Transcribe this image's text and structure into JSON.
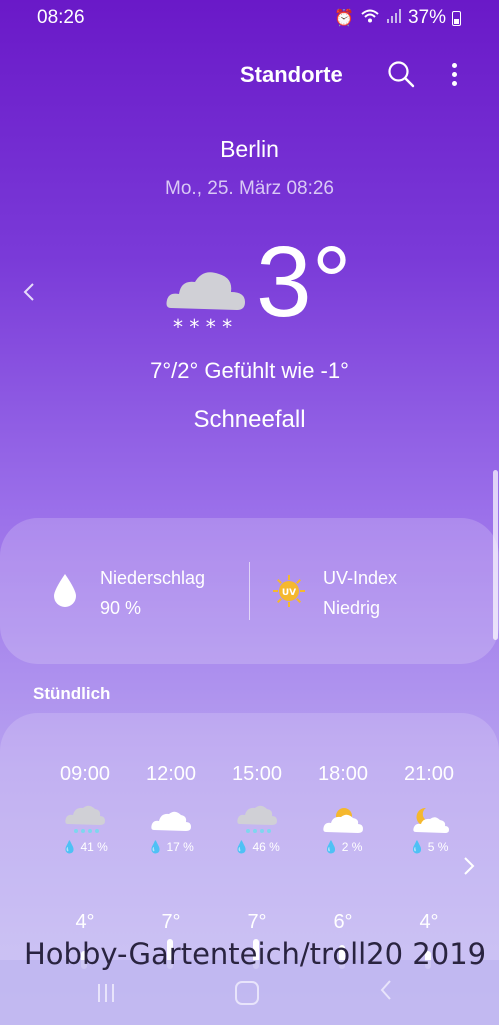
{
  "status_bar": {
    "time": "08:26",
    "battery": "37%"
  },
  "top_bar": {
    "title": "Standorte"
  },
  "location": {
    "city": "Berlin",
    "date": "Mo., 25. März 08:26"
  },
  "current": {
    "temperature": "3°",
    "feels_line": "7°/2° Gefühlt wie -1°",
    "condition": "Schneefall",
    "icon": "snow-cloud-icon"
  },
  "details": {
    "precip_label": "Niederschlag",
    "precip_value": "90 %",
    "uv_label": "UV-Index",
    "uv_value": "Niedrig",
    "uv_badge": "UV"
  },
  "hourly": {
    "label": "Stündlich",
    "items": [
      {
        "time": "09:00",
        "icon": "rain-cloud-icon",
        "precip": "41 %",
        "temp": "4°"
      },
      {
        "time": "12:00",
        "icon": "cloud-icon",
        "precip": "17 %",
        "temp": "7°"
      },
      {
        "time": "15:00",
        "icon": "rain-cloud-icon",
        "precip": "46 %",
        "temp": "7°"
      },
      {
        "time": "18:00",
        "icon": "sun-cloud-icon",
        "precip": "2 %",
        "temp": "6°"
      },
      {
        "time": "21:00",
        "icon": "moon-cloud-icon",
        "precip": "5 %",
        "temp": "4°"
      }
    ]
  },
  "watermark": "Hobby-Gartenteich/troll20 2019",
  "colors": {
    "accent": "#6a19c8",
    "cloud": "#cfcfd4",
    "sun": "#f5b82e"
  }
}
